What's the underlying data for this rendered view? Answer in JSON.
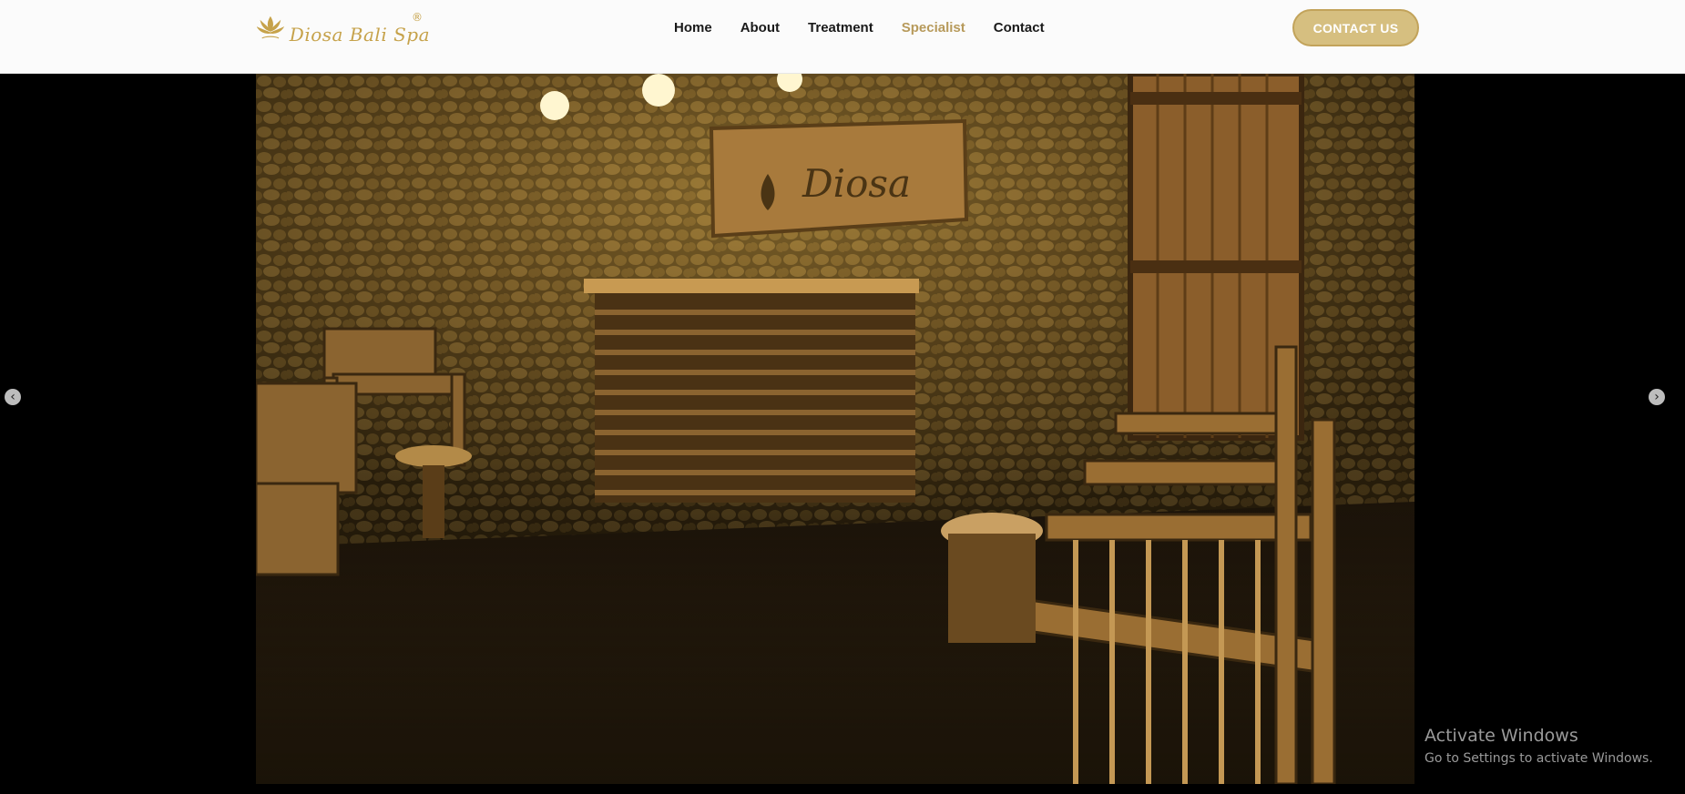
{
  "header": {
    "logo_text": "Diosa Bali Spa",
    "logo_reg": "®",
    "nav": [
      {
        "label": "Home",
        "active": false
      },
      {
        "label": "About",
        "active": false
      },
      {
        "label": "Treatment",
        "active": false
      },
      {
        "label": "Specialist",
        "active": true
      },
      {
        "label": "Contact",
        "active": false
      }
    ],
    "contact_button": "CONTACT US"
  },
  "slider": {
    "prev_icon": "chevron-left-icon",
    "next_icon": "chevron-right-icon",
    "sign_text": "Diosa"
  },
  "watermark": {
    "title": "Activate Windows",
    "subtitle": "Go to Settings to activate Windows."
  },
  "colors": {
    "accent": "#c6a24a",
    "active_nav": "#b79a5b",
    "button_bg": "#d6bf80"
  }
}
